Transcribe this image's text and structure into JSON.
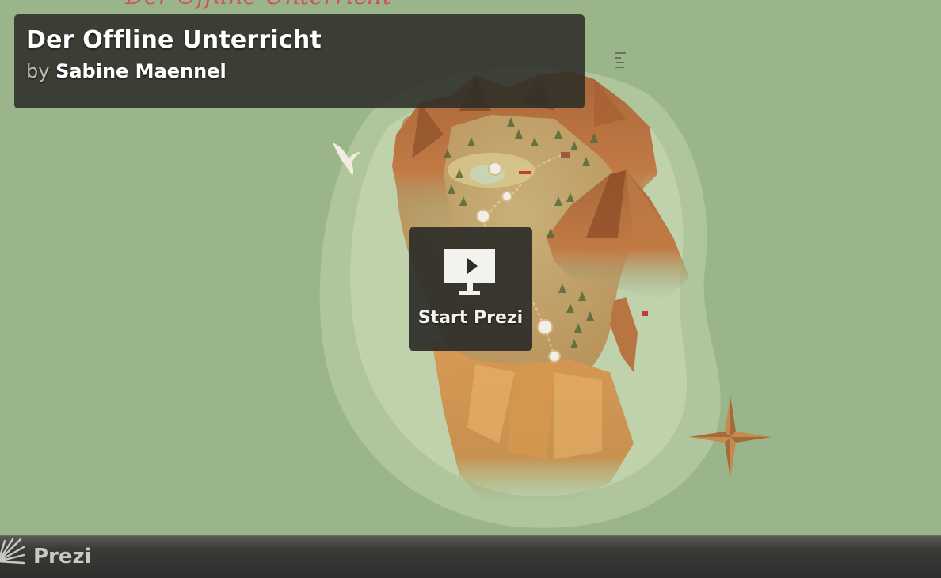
{
  "presentation": {
    "background_title": "Der Offline Unterricht",
    "title": "Der Offline Unterricht",
    "by_prefix": "by",
    "author": "Sabine Maennel"
  },
  "start_button": {
    "label": "Start Prezi",
    "icon": "presentation-play-icon"
  },
  "footer": {
    "brand": "Prezi",
    "logo_icon": "prezi-logo-icon"
  },
  "colors": {
    "sea": "#9bb58a",
    "shallow": "#b7cca4",
    "sand": "#c8aa70",
    "mountain": "#b8743e",
    "overlay": "#2d2d28",
    "footer": "#3a3a38"
  }
}
